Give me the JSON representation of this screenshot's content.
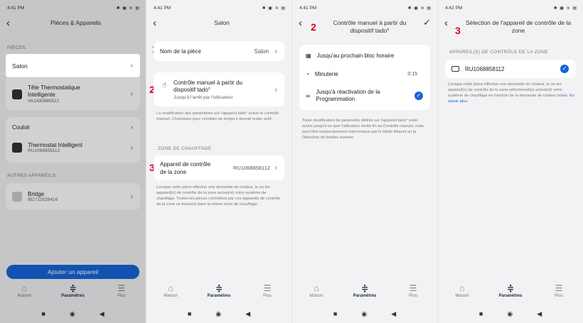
{
  "colors": {
    "accent": "#1565d8",
    "annotation": "#d8001c"
  },
  "s1": {
    "time": "4:41 PM",
    "status_icons": "✱ ▣ ≋ ▤",
    "title": "Pièces & Appareils",
    "section_pieces": "PIÈCES",
    "salon": "Salon",
    "tete_name": "Tête Thermostatique Intelligente",
    "tete_serial": "VA1430880512",
    "couloir": "Couloir",
    "thermo_name": "Thermostat Intelligent",
    "thermo_serial": "RU1068858112",
    "section_autres": "AUTRES APPAREILS",
    "bridge_name": "Bridge",
    "bridge_serial": "IB1712028416",
    "add_button": "Ajouter un appareil"
  },
  "s2": {
    "time": "4:41 PM",
    "status_icons": "✱ ▣ ≋ ▤",
    "title": "Salon",
    "num1": "1",
    "nom_label": "Nom de la pièce",
    "nom_value": "Salon",
    "num2": "2",
    "controle_label": "Contrôle manuel à partir du dispositif tado°",
    "controle_sub": "Jusqu'à l'arrêt par l'utilisateur",
    "note1": "La modification des paramètres sur l'appareil tado° active le contrôle manuel. Choisissez pour combien de temps il devrait rester actif.",
    "section_zone": "ZONE DE CHAUFFAGE",
    "num3": "3",
    "appareil_label": "Appareil de contrôle de la zone",
    "appareil_value": "RU1068858112",
    "note2": "Lorsque cette pièce effectue une demande de chaleur, le ou les appareil(s) de contrôle de la zone active(nt) votre système de chauffage. Toutes les pièces contrôlées par ces appareils de contrôle de la zone se trouvent dans la même zone de chauffage."
  },
  "s3": {
    "time": "4:41 PM",
    "status_icons": "✱ ▣ ≋ ▤",
    "num": "2",
    "title": "Contrôle manuel à partir du dispositif tado°",
    "opt1": "Jusqu'au prochain bloc horaire",
    "opt2": "Minuterie",
    "opt2_value": "0:15",
    "opt3": "Jusqu'à réactivation de la Programmation",
    "note": "Toute modification de paramètre définie sur l'appareil tado° reste active jusqu'à ce que l'utilisateur mette fin au Contrôle manuel, mais peut être temporairement interrompue par le Mode Absent ou la Détection de fenêtre ouverte."
  },
  "s4": {
    "time": "4:42 PM",
    "status_icons": "✱ ▣ ≋ ▤",
    "num": "3",
    "title": "Sélection de l'appareil de contrôle de la zone",
    "section": "APPAREIL(S) DE CONTRÔLE DE LA ZONE",
    "device": "RU1068858112",
    "note": "Lorsque cette pièce effectue une demande de chaleur, le ou les appareil(s) de contrôle de la zone sélectionné(s) active(nt) votre système de chauffage en fonction de la demande de chaleur totale.",
    "link": "En savoir plus."
  },
  "tabs": {
    "maison": "Maison",
    "parametres": "Paramètres",
    "plus": "Plus"
  },
  "icons": {
    "maison": "home-icon",
    "parametres": "sliders-icon",
    "plus": "menu-icon"
  }
}
